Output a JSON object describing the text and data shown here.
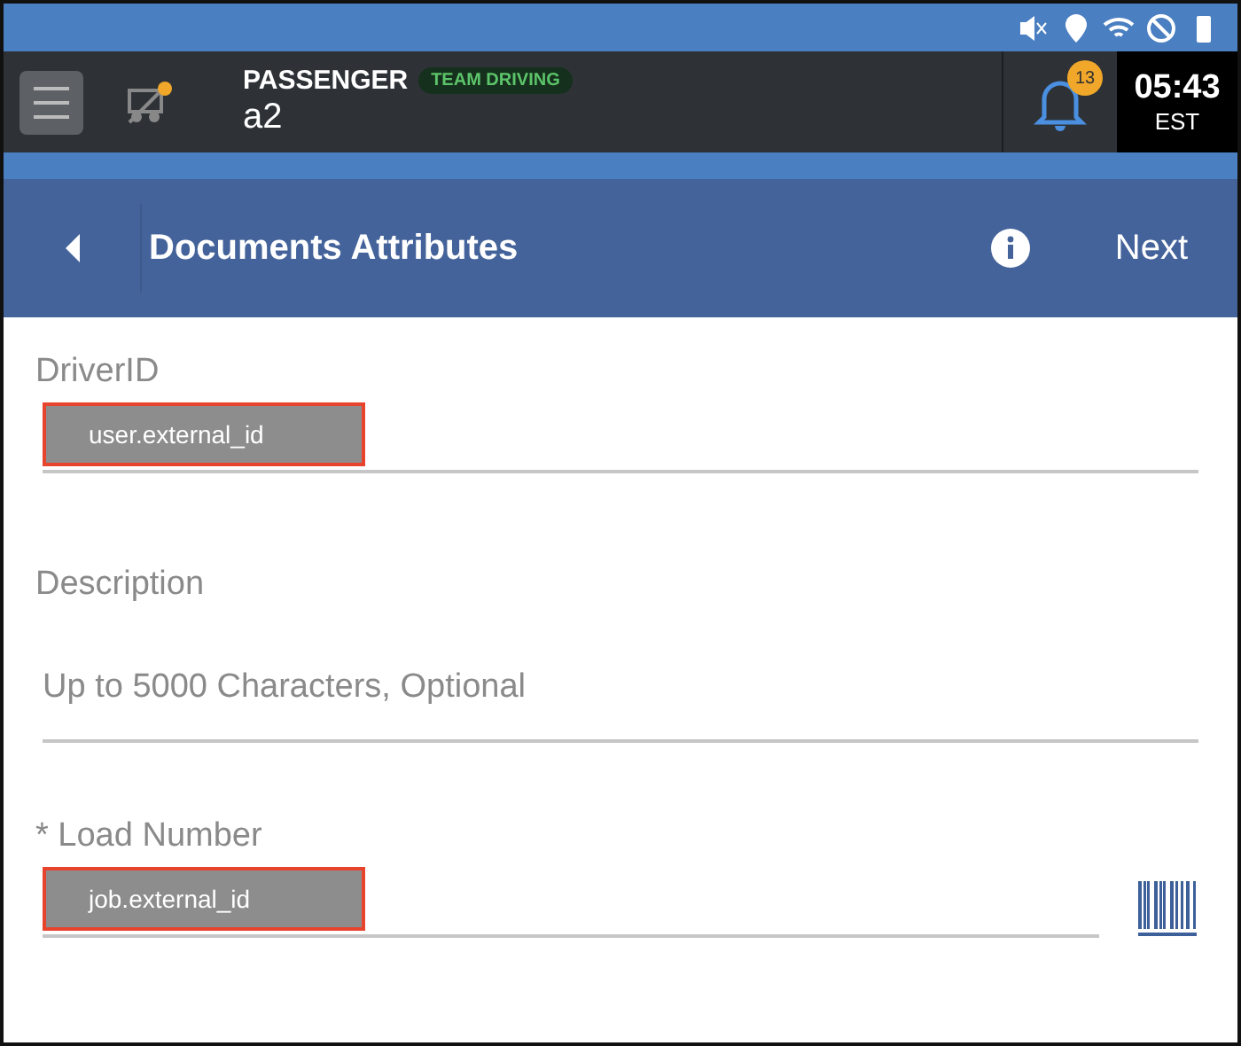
{
  "app_bar": {
    "role": "PASSENGER",
    "badge": "TEAM DRIVING",
    "vehicle": "a2",
    "notifications": "13",
    "time": "05:43",
    "timezone": "EST"
  },
  "header": {
    "title": "Documents Attributes",
    "next": "Next"
  },
  "fields": [
    {
      "kind": "text",
      "label": "DriverID",
      "value": "user.external_id",
      "highlighted": true
    },
    {
      "kind": "text",
      "label": "Description",
      "placeholder": "Up to 5000 Characters, Optional"
    },
    {
      "kind": "scan",
      "label": "* Load Number",
      "value": "job.external_id",
      "highlighted": true
    }
  ]
}
